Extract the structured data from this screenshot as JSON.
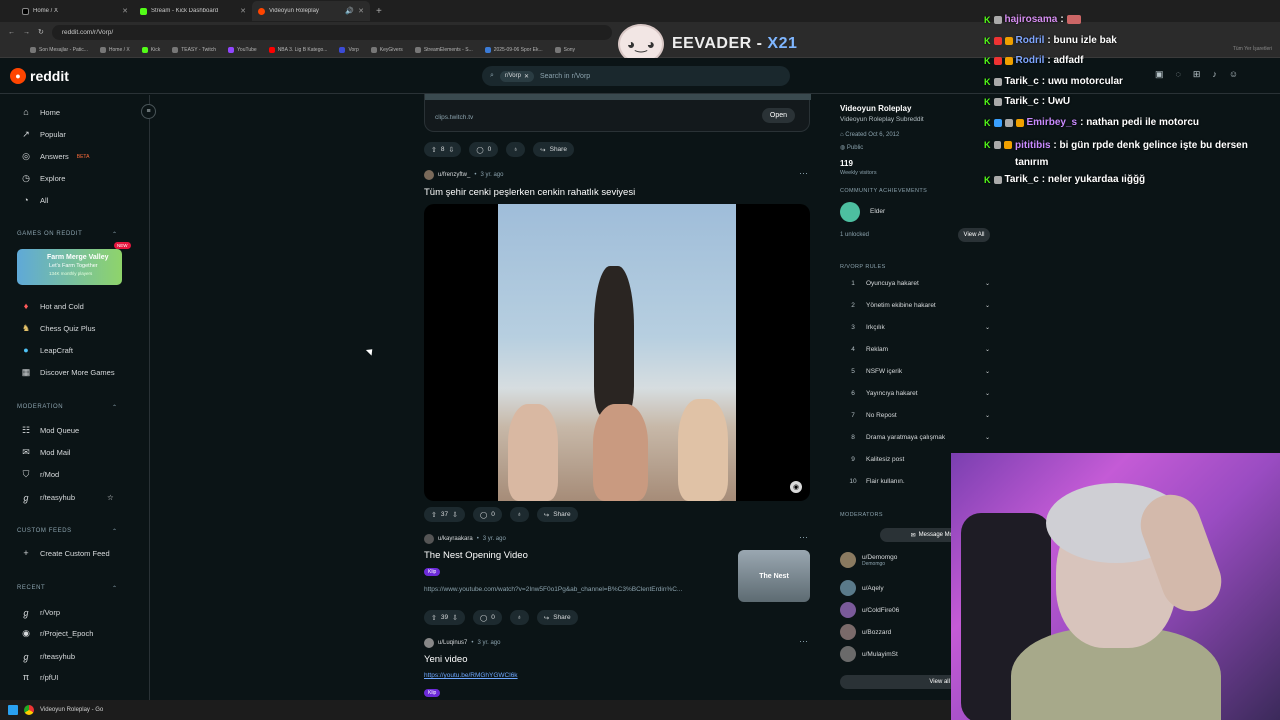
{
  "browser": {
    "tabs": [
      {
        "label": "Home / X",
        "color": "#000000"
      },
      {
        "label": "Stream - Kick Dashboard",
        "color": "#53fc18"
      },
      {
        "label": "Videoyun Roleplay",
        "color": "#ff4500"
      }
    ],
    "url": "reddit.com/r/Vorp/",
    "bookmarks": [
      "Son Mesajlar - Patic...",
      "Home / X",
      "Kick",
      "TEASY - Twitch",
      "YouTube",
      "NBA 3. Lig B Katego...",
      "Vorp",
      "KeyGivers",
      "StreamElements - S...",
      "2025-09-06 Spor Ek...",
      "Sony"
    ],
    "bookmarks_right": "Tüm Yer İşaretleri"
  },
  "overlay": {
    "name": "EEVADER",
    "sep": " - ",
    "tag": "X21"
  },
  "header": {
    "logo": "reddit",
    "search_chip": "r/Vorp",
    "search_placeholder": "Search in r/Vorp"
  },
  "left_nav": {
    "items": [
      "Home",
      "Popular",
      "Answers",
      "Explore",
      "All"
    ],
    "answers_badge": "BETA",
    "games_header": "GAMES ON REDDIT",
    "game_card": {
      "title": "Farm Merge Valley",
      "sub": "Let's Farm Together",
      "players": "134K monthly players",
      "badge": "NEW"
    },
    "games": [
      "Hot and Cold",
      "Chess Quiz Plus",
      "LeapCraft",
      "Discover More Games"
    ],
    "moderation_header": "MODERATION",
    "moderation": [
      "Mod Queue",
      "Mod Mail",
      "r/Mod",
      "r/teasyhub"
    ],
    "custom_header": "CUSTOM FEEDS",
    "custom": [
      "Create Custom Feed"
    ],
    "recent_header": "RECENT",
    "recent": [
      "r/Vorp",
      "r/Project_Epoch",
      "r/teasyhub",
      "r/pfUI"
    ]
  },
  "feed": {
    "link_domain": "clips.twitch.tv",
    "open_label": "Open",
    "posts": [
      {
        "votes": "8",
        "comments": "0",
        "share": "Share"
      },
      {
        "user": "u/frenzyftw_",
        "age": "3 yr. ago",
        "title": "Tüm şehir cenki peşlerken cenkin rahatlık seviyesi",
        "votes": "37",
        "comments": "0",
        "share": "Share"
      },
      {
        "user": "u/kayraakara",
        "age": "3 yr. ago",
        "title": "The Nest Opening Video",
        "flair": "Klip",
        "link": "https://www.youtube.com/watch?v=2Inw5F0o1Pg&ab_channel=B%C3%BClentErdin%C...",
        "thumb": "The Nest",
        "votes": "39",
        "comments": "0",
        "share": "Share"
      },
      {
        "user": "u/Luqinus7",
        "age": "3 yr. ago",
        "title": "Yeni video",
        "link": "https://youtu.be/RMGhYGWCl6k",
        "flair": "Klip"
      }
    ]
  },
  "sidebar": {
    "name": "Videoyun Roleplay",
    "desc": "Videoyun Roleplay Subreddit",
    "created": "Created Oct 6, 2012",
    "visibility": "Public",
    "visitors": "119",
    "visitors_label": "Weekly visitors",
    "achievements_header": "COMMUNITY ACHIEVEMENTS",
    "achievement": "Elder",
    "unlocked": "1 unlocked",
    "view_all": "View All",
    "rules_header": "R/VORP RULES",
    "rules": [
      "Oyuncuya hakaret",
      "Yönetim ekibine hakaret",
      "Irkçılık",
      "Reklam",
      "NSFW içerik",
      "Yayıncıya hakaret",
      "No Repost",
      "Drama yaratmaya çalışmak",
      "Kalitesiz post",
      "Flair kullanın."
    ],
    "mods_header": "MODERATORS",
    "message_mods": "Message Mods",
    "mods": [
      {
        "name": "u/Demomgo",
        "sub": "Demomgo"
      },
      {
        "name": "u/Aqely",
        "sub": ""
      },
      {
        "name": "u/ColdFire06",
        "sub": ""
      },
      {
        "name": "u/Bozzard",
        "sub": ""
      },
      {
        "name": "u/MulayimSt",
        "sub": ""
      }
    ],
    "view_all_mods": "View all moderators"
  },
  "chat": [
    {
      "user": "hajirosama",
      "msg": ":",
      "color": "#d58ef0"
    },
    {
      "user": "Rodril",
      "msg": ": bunu izle bak",
      "color": "#7fa6ff"
    },
    {
      "user": "Rodril",
      "msg": ": adfadf",
      "color": "#7fa6ff"
    },
    {
      "user": "Tarik_c",
      "msg": ": uwu motorcular",
      "color": "#ffffff"
    },
    {
      "user": "Tarik_c",
      "msg": ": UwU",
      "color": "#ffffff"
    },
    {
      "user": "Emirbey_s",
      "msg": ": nathan pedi ile motorcu",
      "color": "#c98bff"
    },
    {
      "user": "pititibis",
      "msg": ": bi gün rpde denk gelince işte bu dersen tanırım",
      "color": "#c98bff"
    },
    {
      "user": "Tarik_c",
      "msg": ": neler yukardaa ıiğğğ",
      "color": "#ffffff"
    }
  ],
  "taskbar": {
    "app": "Videoyun Roleplay - Go"
  }
}
